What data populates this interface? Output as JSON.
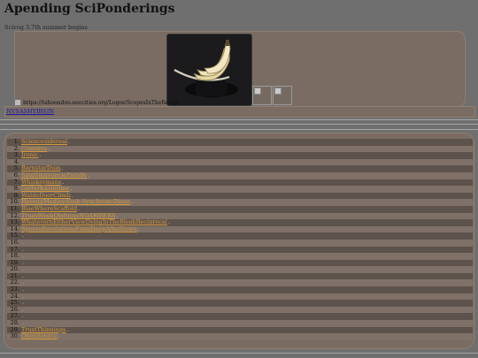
{
  "header": {
    "title": "Apending SciPonderings",
    "subtitle": "Scivog 3.7th summer begins",
    "logo_alt": "https://tahoondoo.neocities.org/Logos/ScopesInTheRough"
  },
  "nav": {
    "link_label": "NVSASHYIBSJN"
  },
  "list": {
    "items": [
      {
        "number": "1.",
        "label": "Sciencesidereal",
        "sep": "."
      },
      {
        "number": "2.",
        "label": "Contains",
        "sep": "."
      },
      {
        "number": "3.",
        "label": "Ironic",
        "sep": "."
      },
      {
        "number": "4.",
        "label": "",
        "sep": "."
      },
      {
        "number": "5.",
        "label": "BarnstarDuin",
        "sep": "."
      },
      {
        "number": "6.",
        "label": "SingSingsunciaParade",
        "sep": "."
      },
      {
        "number": "7.",
        "label": "Whiskeymans",
        "sep": "."
      },
      {
        "number": "8.",
        "label": "GetterKazintime",
        "sep": "."
      },
      {
        "number": "9.",
        "label": "WaldoDoorClimb",
        "sep": "."
      },
      {
        "number": "10.",
        "label": "HasengMedjeyAhub-SynchroneDiene",
        "sep": "."
      },
      {
        "number": "11.",
        "label": "BlaeWhereScaffold",
        "sep": "."
      },
      {
        "number": "12.",
        "label": "TruesWeekObducesNOAMBERS",
        "sep": "."
      },
      {
        "number": "13.",
        "label": "WhatevernEitherViewDyingInTheBleakReciprocal",
        "sep": "."
      },
      {
        "number": "14.",
        "label": "SporesRevolutionsFinalDeepAfterDown",
        "sep": "."
      },
      {
        "number": "15.",
        "label": "",
        "sep": "."
      },
      {
        "number": "16.",
        "label": "",
        "sep": "."
      },
      {
        "number": "17.",
        "label": "",
        "sep": "."
      },
      {
        "number": "18.",
        "label": "",
        "sep": "."
      },
      {
        "number": "19.",
        "label": "",
        "sep": "."
      },
      {
        "number": "20.",
        "label": "",
        "sep": "."
      },
      {
        "number": "21.",
        "label": "",
        "sep": "."
      },
      {
        "number": "22.",
        "label": "",
        "sep": "."
      },
      {
        "number": "23.",
        "label": "",
        "sep": "."
      },
      {
        "number": "24.",
        "label": "",
        "sep": "."
      },
      {
        "number": "25.",
        "label": "",
        "sep": "."
      },
      {
        "number": "26.",
        "label": "",
        "sep": "."
      },
      {
        "number": "27.",
        "label": "",
        "sep": "."
      },
      {
        "number": "28.",
        "label": "",
        "sep": "."
      },
      {
        "number": "29.",
        "label": "TrustThinnings",
        "sep": "."
      },
      {
        "number": "30.",
        "label": "OpenSource",
        "sep": "."
      }
    ]
  },
  "colors": {
    "page_bg": "#6f6f6f",
    "panel_bg": "#7a6c62",
    "stripe_bg": "#5e534c",
    "link_orange": "#d59a3c",
    "nav_link_blue": "#1a1aa8"
  },
  "icons": {
    "header_image": "bananas-photo",
    "broken_image": "broken-image-icon"
  }
}
